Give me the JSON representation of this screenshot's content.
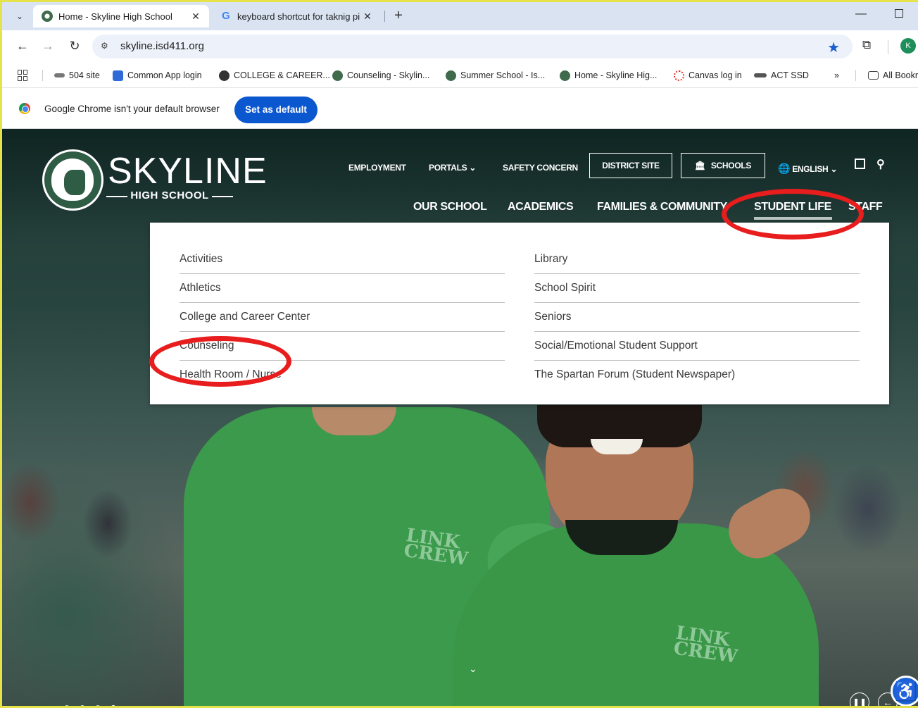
{
  "browser": {
    "tabs": [
      {
        "title": "Home - Skyline High School",
        "close": "✕",
        "active": true
      },
      {
        "title": "keyboard shortcut for taknig pi",
        "close": "✕",
        "active": false
      }
    ],
    "new_tab": "+",
    "url": "skyline.isd411.org",
    "profile_initial": "K",
    "bookmarks": [
      {
        "label": "504 site",
        "icon_color": "#777777"
      },
      {
        "label": "Common App login",
        "icon_color": "#2f6bd8"
      },
      {
        "label": "COLLEGE & CAREER...",
        "icon_color": "#333333"
      },
      {
        "label": "Counseling - Skylin...",
        "icon_color": "#3f6a4c"
      },
      {
        "label": "Summer School - Is...",
        "icon_color": "#3f6a4c"
      },
      {
        "label": "Home - Skyline Hig...",
        "icon_color": "#3f6a4c"
      },
      {
        "label": "Canvas log in",
        "icon_color": "#e0332a"
      },
      {
        "label": "ACT SSD",
        "icon_color": "#555555"
      }
    ],
    "bookmarks_overflow": "»",
    "all_bookmarks": "All Bookm",
    "infobar_text": "Google Chrome isn't your default browser",
    "set_default_label": "Set as default"
  },
  "site": {
    "name": "SKYLINE",
    "subtitle": "HIGH SCHOOL",
    "utility_nav": {
      "employment": "EMPLOYMENT",
      "portals": "PORTALS",
      "safety": "SAFETY CONCERN",
      "district": "DISTRICT SITE",
      "schools": "SCHOOLS",
      "language": "ENGLISH"
    },
    "main_nav": {
      "our_school": "OUR SCHOOL",
      "academics": "ACADEMICS",
      "families": "FAMILIES & COMMUNITY",
      "student_life": "STUDENT LIFE",
      "staff": "STAFF"
    },
    "dropdown_left": [
      "Activities",
      "Athletics",
      "College and Career Center",
      "Counseling",
      "Health Room / Nurse"
    ],
    "dropdown_right": [
      "Library",
      "School Spirit",
      "Seniors",
      "Social/Emotional Student Support",
      "The Spartan Forum (Student Newspaper)"
    ],
    "shirt_print": "LINK CREW",
    "annotation_color": "#e81d1d"
  }
}
